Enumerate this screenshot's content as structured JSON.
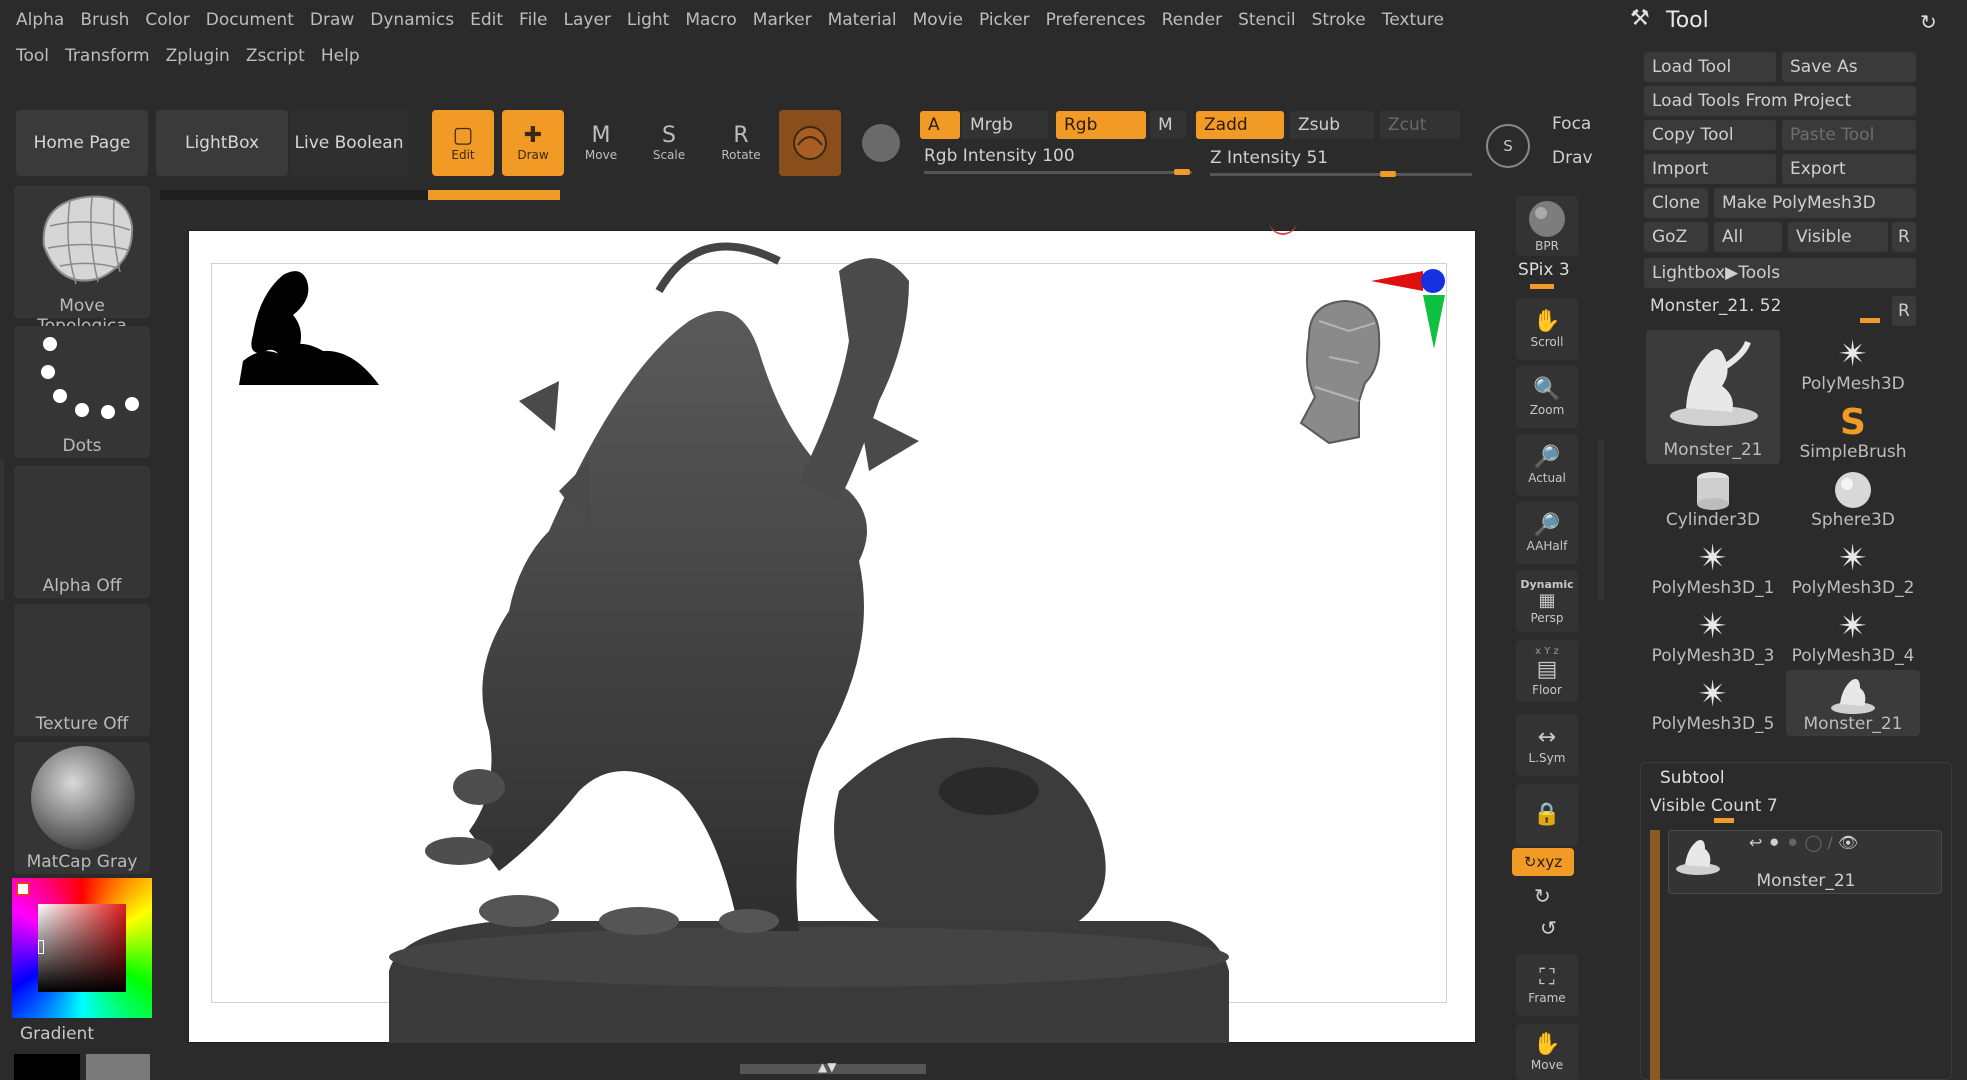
{
  "menu": {
    "row1": [
      "Alpha",
      "Brush",
      "Color",
      "Document",
      "Draw",
      "Dynamics",
      "Edit",
      "File",
      "Layer",
      "Light",
      "Macro",
      "Marker",
      "Material",
      "Movie",
      "Picker",
      "Preferences",
      "Render",
      "Stencil",
      "Stroke",
      "Texture"
    ],
    "row2": [
      "Tool",
      "Transform",
      "Zplugin",
      "Zscript",
      "Help"
    ]
  },
  "toolbar": {
    "home_page": "Home Page",
    "lightbox": "LightBox",
    "live_boolean": "Live Boolean",
    "edit": "Edit",
    "draw": "Draw",
    "move": "Move",
    "scale": "Scale",
    "rotate": "Rotate",
    "a": "A",
    "mrgb": "Mrgb",
    "rgb": "Rgb",
    "m": "M",
    "zadd": "Zadd",
    "zsub": "Zsub",
    "zcut": "Zcut",
    "rgb_intensity_label": "Rgb Intensity",
    "rgb_intensity_value": "100",
    "z_intensity_label": "Z Intensity",
    "z_intensity_value": "51",
    "focal": "Foca",
    "draw_size": "Drav",
    "move_icon_letter": "M",
    "scale_icon_letter": "S",
    "rotate_icon_letter": "R",
    "symmetry_icon_letter": "S"
  },
  "left_panel": {
    "brush": "Move Topologica",
    "stroke": "Dots",
    "alpha": "Alpha Off",
    "texture": "Texture Off",
    "material": "MatCap Gray",
    "gradient": "Gradient"
  },
  "shelf": {
    "bpr": "BPR",
    "spix": "SPix 3",
    "scroll": "Scroll",
    "zoom": "Zoom",
    "actual": "Actual",
    "aahalf": "AAHalf",
    "dynamic": "Dynamic",
    "persp": "Persp",
    "floor": "Floor",
    "lsym": "L.Sym",
    "xyz": "↻xyz",
    "frame": "Frame",
    "move": "Move",
    "floor_axes": "x Y z"
  },
  "tool_panel": {
    "title": "Tool",
    "load_tool": "Load Tool",
    "save_as": "Save As",
    "load_from_project": "Load Tools From Project",
    "copy_tool": "Copy Tool",
    "paste_tool": "Paste Tool",
    "import": "Import",
    "export": "Export",
    "clone": "Clone",
    "make_polymesh": "Make PolyMesh3D",
    "goz": "GoZ",
    "all": "All",
    "visible": "Visible",
    "r": "R",
    "lightbox_tools": "Lightbox▶Tools",
    "current_tool": "Monster_21. 52",
    "thumbs": [
      {
        "label": "Monster_21",
        "icon": "monster-thumbnail"
      },
      {
        "label": "PolyMesh3D",
        "icon": "star-icon"
      },
      {
        "label": "SimpleBrush",
        "icon": "simplebrush-icon"
      },
      {
        "label": "Cylinder3D",
        "icon": "cylinder-icon"
      },
      {
        "label": "Sphere3D",
        "icon": "sphere-icon"
      },
      {
        "label": "PolyMesh3D_1",
        "icon": "star-icon"
      },
      {
        "label": "PolyMesh3D_2",
        "icon": "star-icon"
      },
      {
        "label": "PolyMesh3D_3",
        "icon": "star-icon"
      },
      {
        "label": "PolyMesh3D_4",
        "icon": "star-icon"
      },
      {
        "label": "PolyMesh3D_5",
        "icon": "star-icon"
      },
      {
        "label": "Monster_21",
        "icon": "monster-thumbnail"
      }
    ],
    "subtool": "Subtool",
    "visible_count": "Visible Count 7",
    "subtool_item": "Monster_21"
  },
  "colors": {
    "accent": "#f29a26",
    "background": "#2b2b2b",
    "panel": "#3a3a3a"
  }
}
